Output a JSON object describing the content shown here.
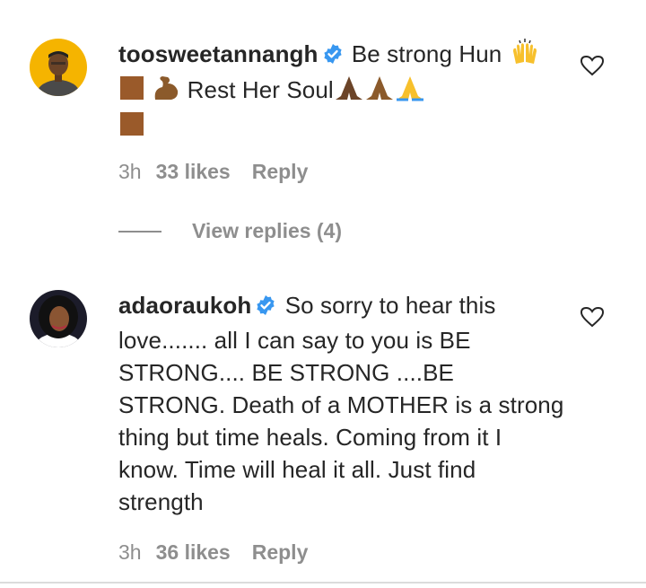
{
  "comments": [
    {
      "username": "toosweetannangh",
      "verified": true,
      "text_part1": "Be strong Hun",
      "text_part2": "Rest Her Soul",
      "emojis": [
        "raising-hands-emoji",
        "brown-square-emoji",
        "flexed-biceps-emoji",
        "folded-hands-emoji"
      ],
      "time": "3h",
      "likes": "33 likes",
      "reply_label": "Reply"
    },
    {
      "username": "adaoraukoh",
      "verified": true,
      "text": "So sorry to hear this love....... all I can say to you is BE STRONG.... BE STRONG ....BE STRONG. Death of a MOTHER is a strong thing but time heals. Coming from it I know. Time will heal it all. Just find strength",
      "time": "3h",
      "likes": "36 likes",
      "reply_label": "Reply"
    }
  ],
  "view_replies_label": "View replies (4)",
  "colors": {
    "text": "#262626",
    "secondary": "#8e8e8e",
    "verified_blue": "#3897f0",
    "avatar1_bg": "#f5b400",
    "emoji_brown": "#9a5a2a"
  }
}
